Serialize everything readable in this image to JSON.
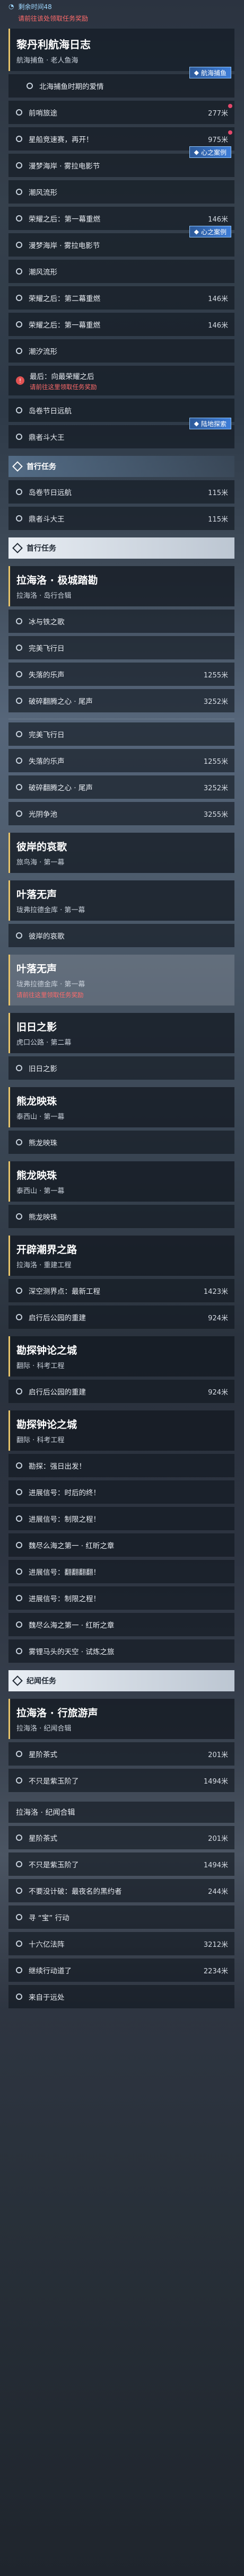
{
  "top": {
    "status_time": "剩余时间48",
    "red_note": "请前往该处领取任务奖励",
    "title": "黎丹利航海日志",
    "subtitle": "航海捕鱼 · 老人鱼海"
  },
  "group1": [
    {
      "label": "北海捕鱼时期的爱情",
      "dist": "",
      "badge": "航海捕鱼",
      "done": false,
      "sub": true
    },
    {
      "label": "前哨旅途",
      "dist": "277米",
      "done": false,
      "red": true
    },
    {
      "label": "星船竞速赛，再开！",
      "dist": "975米",
      "done": false,
      "red": true
    },
    {
      "label": "漫梦海岸 · 雾拉电影节",
      "dist": "",
      "badge": "心之案例",
      "done": false
    },
    {
      "label": "潮风流形",
      "dist": "",
      "done": false
    },
    {
      "label": "荣耀之后：第一幕重燃",
      "dist": "146米",
      "done": false
    },
    {
      "label": "漫梦海岸 · 雾拉电影节",
      "dist": "",
      "badge": "心之案例",
      "done": false
    },
    {
      "label": "潮风流形",
      "dist": "",
      "done": false
    },
    {
      "label": "荣耀之后：第二幕重燃",
      "dist": "146米",
      "done": false
    },
    {
      "label": "荣耀之后：第一幕重燃",
      "dist": "146米",
      "done": false
    },
    {
      "label": "潮汐流形",
      "dist": "",
      "done": false
    }
  ],
  "warn_item": {
    "label": "最后：向最荣耀之后",
    "note": "请前往这里领取任务奖励"
  },
  "group1b": [
    {
      "label": "岛卷节日远航",
      "dist": "",
      "done": false
    },
    {
      "label": "鼎者斗大王",
      "dist": "",
      "badge": "陆地探索",
      "done": false
    }
  ],
  "sec_daily": "首行任务",
  "group2": [
    {
      "label": "岛卷节日远航",
      "dist": "115米"
    },
    {
      "label": "鼎者斗大王",
      "dist": "115米"
    }
  ],
  "sec_main": "首行任务",
  "ch1": {
    "title": "拉海洛 · 极城踏勘",
    "sub": "拉海洛 · 岛行合辑"
  },
  "group3": [
    {
      "label": "冰与铁之歌",
      "dist": ""
    },
    {
      "label": "完美飞行日",
      "dist": ""
    },
    {
      "label": "失落的乐声",
      "dist": "1255米"
    },
    {
      "label": "破碎翻腾之心 · 尾声",
      "dist": "3252米"
    }
  ],
  "group4": [
    {
      "label": "完美飞行日",
      "dist": ""
    },
    {
      "label": "失落的乐声",
      "dist": "1255米"
    },
    {
      "label": "破碎翻腾之心 · 尾声",
      "dist": "3252米"
    },
    {
      "label": "光阴争池",
      "dist": "3255米"
    }
  ],
  "ch2": {
    "title": "彼岸的哀歌",
    "sub": "旅鸟海 · 第一幕"
  },
  "ch3": {
    "title": "叶落无声",
    "sub": "珑弗拉德金库 · 第一幕"
  },
  "group5": [
    {
      "label": "彼岸的哀歌",
      "dist": ""
    }
  ],
  "ch4": {
    "title": "叶落无声",
    "sub": "珑弗拉德金库 · 第一幕",
    "note": "请前往这里领取任务奖励"
  },
  "ch5": {
    "title": "旧日之影",
    "sub": "虎口公路 · 第二幕"
  },
  "group6": [
    {
      "label": "旧日之影",
      "dist": ""
    }
  ],
  "ch6": {
    "title": "熊龙映珠",
    "sub": "泰西山 · 第一幕"
  },
  "group7": [
    {
      "label": "熊龙映珠",
      "dist": ""
    }
  ],
  "ch7": {
    "title": "熊龙映珠",
    "sub": "泰西山 · 第一幕"
  },
  "group8": [
    {
      "label": "熊龙映珠",
      "dist": ""
    }
  ],
  "ch8": {
    "title": "开辟潮界之路",
    "sub": "拉海洛 · 重建工程"
  },
  "group9": [
    {
      "label": "深空测界点：最新工程",
      "dist": "1423米"
    },
    {
      "label": "启行后公园的重建",
      "dist": "924米"
    }
  ],
  "ch9": {
    "title": "勘探钟论之城",
    "sub": "翻际 · 科考工程"
  },
  "group10": [
    {
      "label": "启行后公园的重建",
      "dist": "924米"
    }
  ],
  "ch10": {
    "title": "勘探钟论之城",
    "sub": "翻际 · 科考工程"
  },
  "group11": [
    {
      "label": "勘探：强日出发！",
      "dist": ""
    },
    {
      "label": "进展信号：时后的终！",
      "dist": ""
    },
    {
      "label": "进展信号：制限之程！",
      "dist": ""
    },
    {
      "label": "魏尽么海之第一 · 红昕之章",
      "dist": ""
    },
    {
      "label": "进展信号：翻翻翻翻！",
      "dist": ""
    },
    {
      "label": "进展信号：制限之程！",
      "dist": ""
    },
    {
      "label": "魏尽么海之第一 · 红昕之章",
      "dist": ""
    },
    {
      "label": "雾锂马头的天空 · 试炼之旅",
      "dist": ""
    }
  ],
  "sec_side": "纪闻任务",
  "ch11": {
    "title": "拉海洛 · 行旅游声",
    "sub": "拉海洛 · 纪闻合辑"
  },
  "group12": [
    {
      "label": "星阶茶式",
      "dist": "201米"
    },
    {
      "label": "不只是紫玉阶了",
      "dist": "1494米"
    }
  ],
  "mini_head": "拉海洛 · 纪闻合辑",
  "group13": [
    {
      "label": "星阶茶式",
      "dist": "201米"
    },
    {
      "label": "不只是紫玉阶了",
      "dist": "1494米"
    },
    {
      "label": "不要没计破：最夜名的黑约者",
      "dist": "244米"
    },
    {
      "label": "寻 “宝” 行动",
      "dist": ""
    },
    {
      "label": "十六亿法阵",
      "dist": "3212米"
    },
    {
      "label": "继续行动道了",
      "dist": "2234米"
    },
    {
      "label": "来自于远处",
      "dist": ""
    }
  ],
  "colors": {
    "accent": "#e8c46a",
    "badge": "#3d7dd8",
    "danger": "#e05252"
  }
}
